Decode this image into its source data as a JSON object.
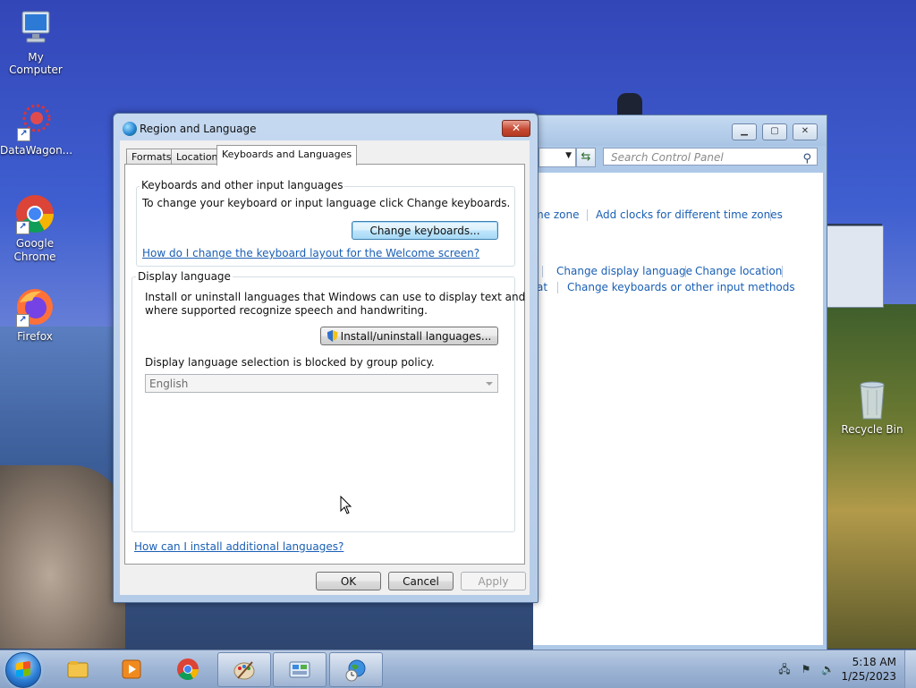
{
  "desktop": {
    "icons": [
      {
        "label": "My Computer",
        "icon": "computer-icon"
      },
      {
        "label": "DataWagon...",
        "icon": "datawagon-icon"
      },
      {
        "label": "Google Chrome",
        "icon": "chrome-icon"
      },
      {
        "label": "Firefox",
        "icon": "firefox-icon"
      },
      {
        "label": "Recycle Bin",
        "icon": "recycle-bin-icon"
      }
    ]
  },
  "control_panel": {
    "search_placeholder": "Search Control Panel",
    "links": {
      "time_zone_partial": "me zone",
      "add_clocks": "Add clocks for different time zones",
      "change_display_language": "Change display language",
      "change_location": "Change location",
      "format_partial": "at",
      "change_keyboards_input": "Change keyboards or other input methods"
    }
  },
  "dialog": {
    "title": "Region and Language",
    "tabs": [
      "Formats",
      "Location",
      "Keyboards and Languages"
    ],
    "active_tab": "Keyboards and Languages",
    "keyboards_group": {
      "label": "Keyboards and other input languages",
      "description": "To change your keyboard or input language click Change keyboards.",
      "button": "Change keyboards...",
      "help_link": "How do I change the keyboard layout for the Welcome screen?"
    },
    "display_group": {
      "label": "Display language",
      "description_line1": "Install or uninstall languages that Windows can use to display text and",
      "description_line2": "where supported recognize speech and handwriting.",
      "install_button": "Install/uninstall languages...",
      "policy_note": "Display language selection is blocked by group policy.",
      "selected_language": "English"
    },
    "additional_link": "How can I install additional languages?",
    "buttons": {
      "ok": "OK",
      "cancel": "Cancel",
      "apply": "Apply"
    }
  },
  "taskbar": {
    "clock_time": "5:18 AM",
    "clock_date": "1/25/2023"
  }
}
